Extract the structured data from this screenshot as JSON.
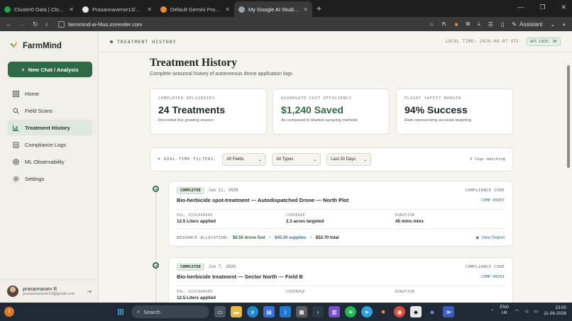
{
  "browser": {
    "tabs": [
      {
        "label": "Cluster0 Data | Cloud: Mo",
        "color": "#1ea84a"
      },
      {
        "label": "Prasannaverse13/Farmmi",
        "color": "#e8e8e8"
      },
      {
        "label": "Default Gemini Project - A",
        "color": "#f08a30"
      },
      {
        "label": "My Google AI Studio App",
        "color": "#9aa3ad"
      }
    ],
    "url": "farmmind-ai-f4us.onrender.com",
    "assistant_label": "Assistant"
  },
  "sidebar": {
    "brand": "FarmMind",
    "new_chat": "New Chat / Analysis",
    "items": [
      {
        "label": "Home",
        "icon": "grid-icon"
      },
      {
        "label": "Field Scans",
        "icon": "search-icon"
      },
      {
        "label": "Treatment History",
        "icon": "bar-chart-icon"
      },
      {
        "label": "Compliance Logs",
        "icon": "clipboard-icon"
      },
      {
        "label": "ML Observability",
        "icon": "target-icon"
      },
      {
        "label": "Settings",
        "icon": "gear-icon"
      }
    ],
    "user": {
      "name": "prasannaram R",
      "email": "prasannaverse13@gmail.com"
    }
  },
  "header": {
    "breadcrumb": "TREATMENT HISTORY",
    "local_time": "LOCAL TIME: 2026-06-07 UTC",
    "gps": "GPS LOCK: OK"
  },
  "page": {
    "title": "Treatment History",
    "subtitle": "Complete seasonal history of autonomous drone application logs"
  },
  "cards": [
    {
      "label": "COMPLETED DELIVERIES",
      "value": "24 Treatments",
      "note": "Recorded this growing season"
    },
    {
      "label": "AGGREGATE COST EFFICIENCY",
      "value": "$1,240 Saved",
      "note": "As compared to blanket spraying methods"
    },
    {
      "label": "FLIGHT SAFETY MARGIN",
      "value": "94% Success",
      "note": "Rate representing accurate targeting"
    }
  ],
  "filters": {
    "label": "REAL-TIME FILTERS:",
    "fields": "All Fields",
    "types": "All Types",
    "range": "Last 30 Days",
    "count": "5 logs matching"
  },
  "logs": [
    {
      "status": "COMPLETED",
      "date": "Jun 11, 2026",
      "compliance_label": "COMPLIANCE CODE",
      "title": "Bio-herbicide spot-treatment — Autodispatched Drone — North Plot",
      "code": "COMP-45057",
      "vol_label": "VOL. DISCHARGED",
      "vol": "12.5 Liters applied",
      "cov_label": "COVERAGE",
      "cov": "2.3 acres targeted",
      "dur_label": "DURATION",
      "dur": "45 mins mins",
      "res_label": "RESOURCE ALLOCATION:",
      "fuel": "$8.50 drone fuel",
      "supplies": "$45.20 supplies",
      "total": "$53.70 total",
      "view": "View Report"
    },
    {
      "status": "COMPLETED",
      "date": "Jun 7, 2026",
      "compliance_label": "COMPLIANCE CODE",
      "title": "Bio-herbicide treatment — Sector North — Field B",
      "code": "COMP-48291",
      "vol_label": "VOL. DISCHARGED",
      "vol": "12.5 Liters applied",
      "cov_label": "COVERAGE",
      "cov": "",
      "dur_label": "DURATION",
      "dur": ""
    }
  ],
  "taskbar": {
    "search": "Search",
    "lang_1": "ENG",
    "lang_2": "UK",
    "time": "23:00",
    "date": "11-06-2026",
    "notify_count": "2"
  }
}
